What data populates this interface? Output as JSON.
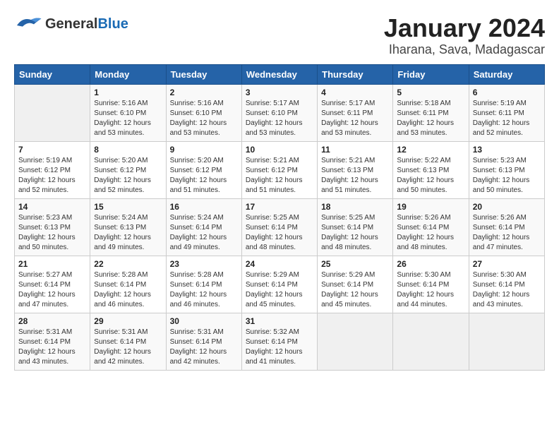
{
  "header": {
    "logo_general": "General",
    "logo_blue": "Blue",
    "title": "January 2024",
    "subtitle": "Iharana, Sava, Madagascar"
  },
  "calendar": {
    "days_of_week": [
      "Sunday",
      "Monday",
      "Tuesday",
      "Wednesday",
      "Thursday",
      "Friday",
      "Saturday"
    ],
    "weeks": [
      [
        {
          "day": "",
          "content": ""
        },
        {
          "day": "1",
          "content": "Sunrise: 5:16 AM\nSunset: 6:10 PM\nDaylight: 12 hours\nand 53 minutes."
        },
        {
          "day": "2",
          "content": "Sunrise: 5:16 AM\nSunset: 6:10 PM\nDaylight: 12 hours\nand 53 minutes."
        },
        {
          "day": "3",
          "content": "Sunrise: 5:17 AM\nSunset: 6:10 PM\nDaylight: 12 hours\nand 53 minutes."
        },
        {
          "day": "4",
          "content": "Sunrise: 5:17 AM\nSunset: 6:11 PM\nDaylight: 12 hours\nand 53 minutes."
        },
        {
          "day": "5",
          "content": "Sunrise: 5:18 AM\nSunset: 6:11 PM\nDaylight: 12 hours\nand 53 minutes."
        },
        {
          "day": "6",
          "content": "Sunrise: 5:19 AM\nSunset: 6:11 PM\nDaylight: 12 hours\nand 52 minutes."
        }
      ],
      [
        {
          "day": "7",
          "content": "Sunrise: 5:19 AM\nSunset: 6:12 PM\nDaylight: 12 hours\nand 52 minutes."
        },
        {
          "day": "8",
          "content": "Sunrise: 5:20 AM\nSunset: 6:12 PM\nDaylight: 12 hours\nand 52 minutes."
        },
        {
          "day": "9",
          "content": "Sunrise: 5:20 AM\nSunset: 6:12 PM\nDaylight: 12 hours\nand 51 minutes."
        },
        {
          "day": "10",
          "content": "Sunrise: 5:21 AM\nSunset: 6:12 PM\nDaylight: 12 hours\nand 51 minutes."
        },
        {
          "day": "11",
          "content": "Sunrise: 5:21 AM\nSunset: 6:13 PM\nDaylight: 12 hours\nand 51 minutes."
        },
        {
          "day": "12",
          "content": "Sunrise: 5:22 AM\nSunset: 6:13 PM\nDaylight: 12 hours\nand 50 minutes."
        },
        {
          "day": "13",
          "content": "Sunrise: 5:23 AM\nSunset: 6:13 PM\nDaylight: 12 hours\nand 50 minutes."
        }
      ],
      [
        {
          "day": "14",
          "content": "Sunrise: 5:23 AM\nSunset: 6:13 PM\nDaylight: 12 hours\nand 50 minutes."
        },
        {
          "day": "15",
          "content": "Sunrise: 5:24 AM\nSunset: 6:13 PM\nDaylight: 12 hours\nand 49 minutes."
        },
        {
          "day": "16",
          "content": "Sunrise: 5:24 AM\nSunset: 6:14 PM\nDaylight: 12 hours\nand 49 minutes."
        },
        {
          "day": "17",
          "content": "Sunrise: 5:25 AM\nSunset: 6:14 PM\nDaylight: 12 hours\nand 48 minutes."
        },
        {
          "day": "18",
          "content": "Sunrise: 5:25 AM\nSunset: 6:14 PM\nDaylight: 12 hours\nand 48 minutes."
        },
        {
          "day": "19",
          "content": "Sunrise: 5:26 AM\nSunset: 6:14 PM\nDaylight: 12 hours\nand 48 minutes."
        },
        {
          "day": "20",
          "content": "Sunrise: 5:26 AM\nSunset: 6:14 PM\nDaylight: 12 hours\nand 47 minutes."
        }
      ],
      [
        {
          "day": "21",
          "content": "Sunrise: 5:27 AM\nSunset: 6:14 PM\nDaylight: 12 hours\nand 47 minutes."
        },
        {
          "day": "22",
          "content": "Sunrise: 5:28 AM\nSunset: 6:14 PM\nDaylight: 12 hours\nand 46 minutes."
        },
        {
          "day": "23",
          "content": "Sunrise: 5:28 AM\nSunset: 6:14 PM\nDaylight: 12 hours\nand 46 minutes."
        },
        {
          "day": "24",
          "content": "Sunrise: 5:29 AM\nSunset: 6:14 PM\nDaylight: 12 hours\nand 45 minutes."
        },
        {
          "day": "25",
          "content": "Sunrise: 5:29 AM\nSunset: 6:14 PM\nDaylight: 12 hours\nand 45 minutes."
        },
        {
          "day": "26",
          "content": "Sunrise: 5:30 AM\nSunset: 6:14 PM\nDaylight: 12 hours\nand 44 minutes."
        },
        {
          "day": "27",
          "content": "Sunrise: 5:30 AM\nSunset: 6:14 PM\nDaylight: 12 hours\nand 43 minutes."
        }
      ],
      [
        {
          "day": "28",
          "content": "Sunrise: 5:31 AM\nSunset: 6:14 PM\nDaylight: 12 hours\nand 43 minutes."
        },
        {
          "day": "29",
          "content": "Sunrise: 5:31 AM\nSunset: 6:14 PM\nDaylight: 12 hours\nand 42 minutes."
        },
        {
          "day": "30",
          "content": "Sunrise: 5:31 AM\nSunset: 6:14 PM\nDaylight: 12 hours\nand 42 minutes."
        },
        {
          "day": "31",
          "content": "Sunrise: 5:32 AM\nSunset: 6:14 PM\nDaylight: 12 hours\nand 41 minutes."
        },
        {
          "day": "",
          "content": ""
        },
        {
          "day": "",
          "content": ""
        },
        {
          "day": "",
          "content": ""
        }
      ]
    ]
  }
}
